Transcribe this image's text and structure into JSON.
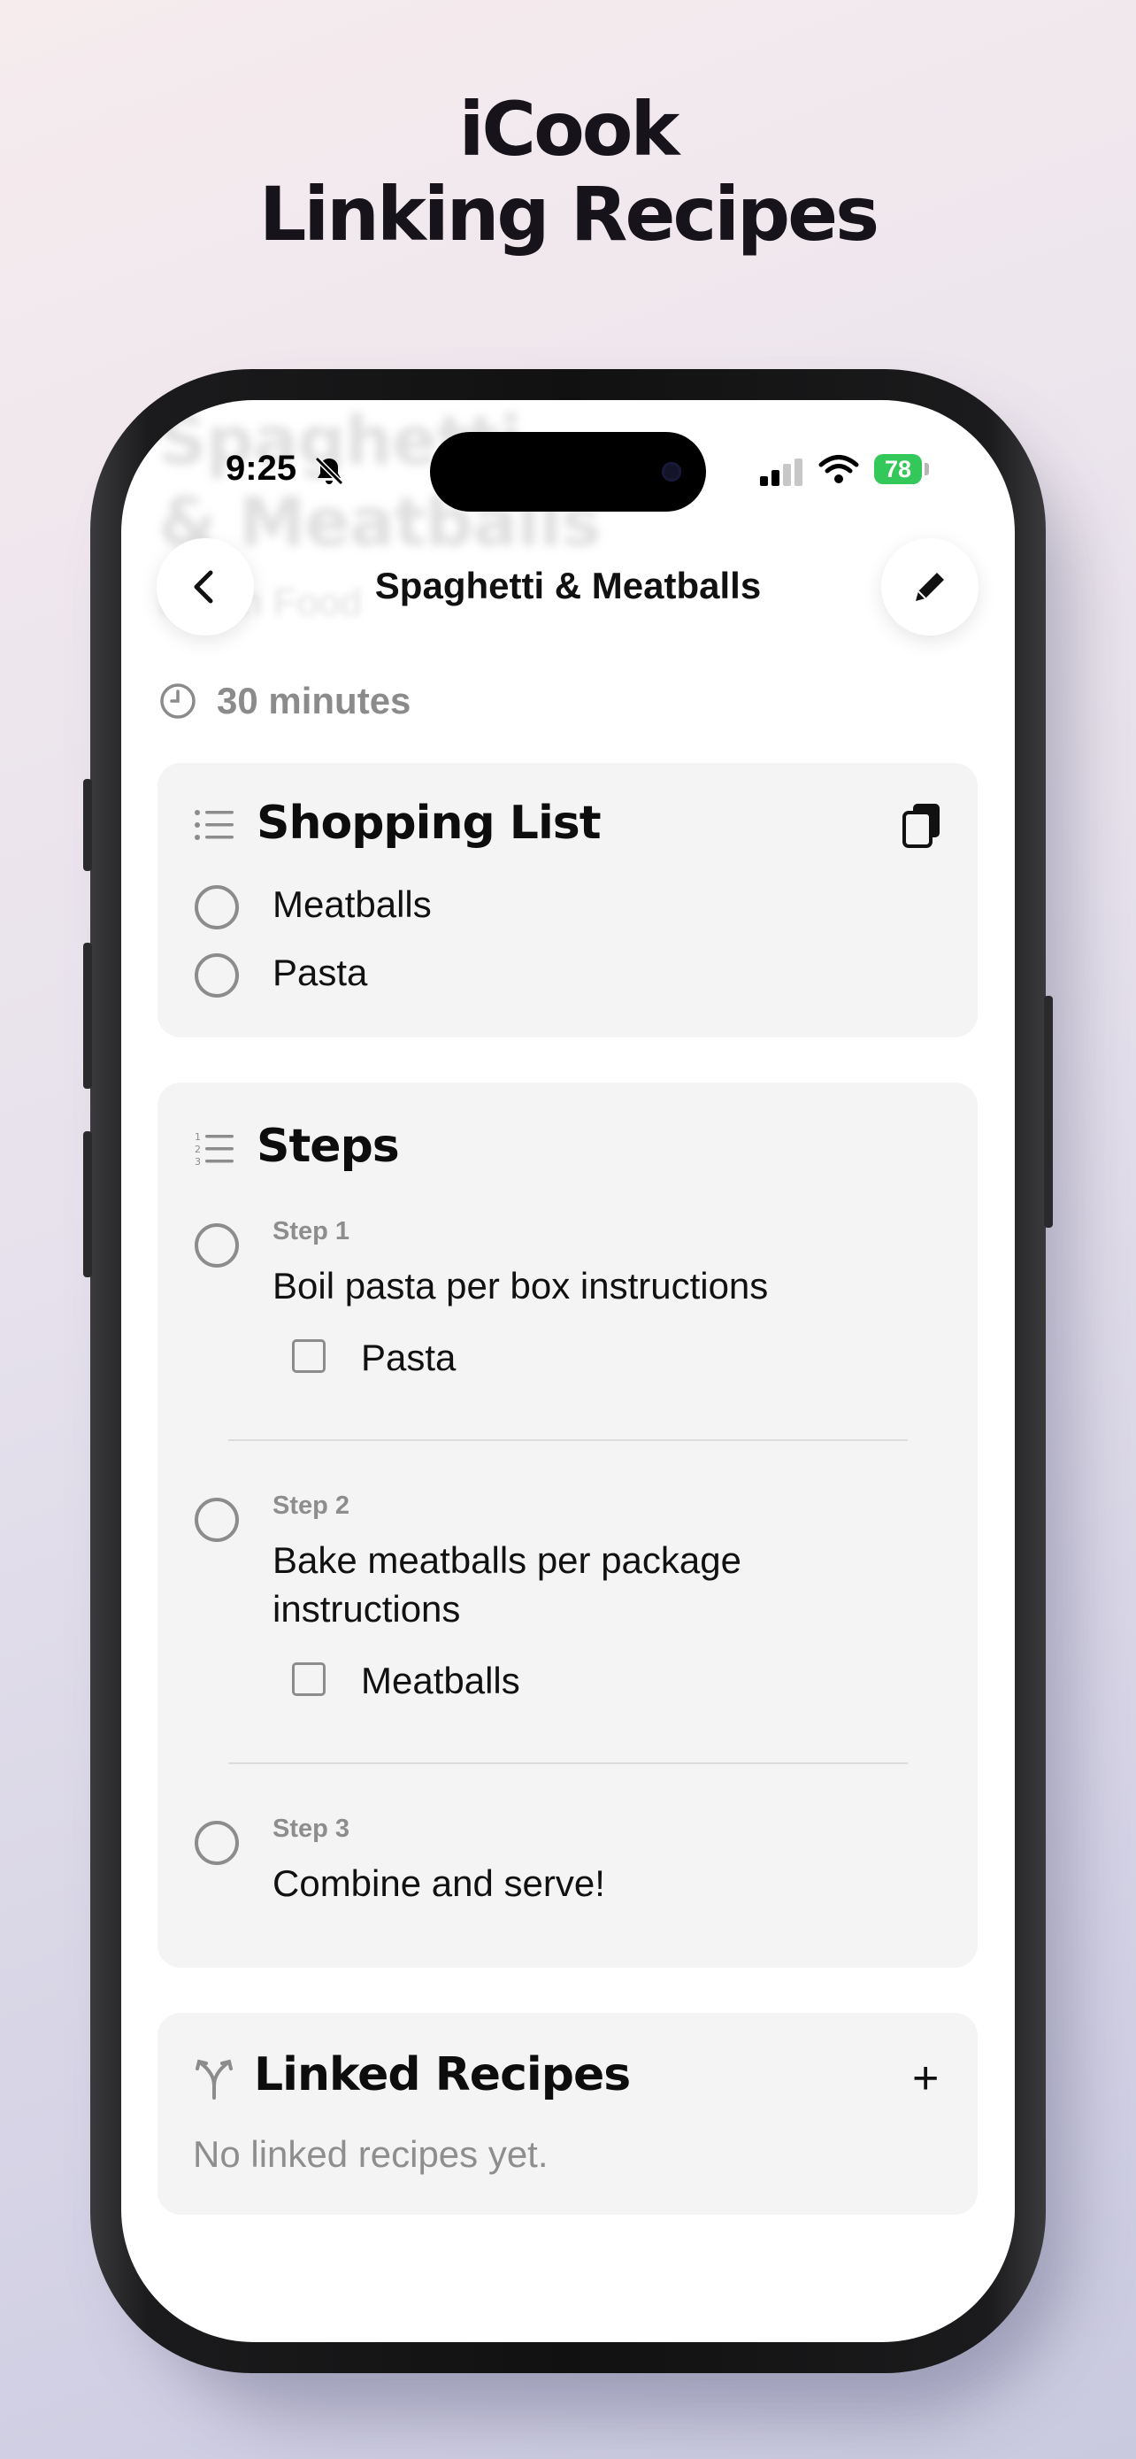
{
  "promo": {
    "line1": "iCook",
    "line2": "Linking Recipes"
  },
  "status_bar": {
    "time": "9:25",
    "battery": "78"
  },
  "background_header": {
    "title_line1": "Spaghetti",
    "title_line2": "& Meatballs",
    "subtitle": "Italian Food"
  },
  "nav": {
    "title": "Spaghetti & Meatballs",
    "back_icon": "chevron-left-icon",
    "edit_icon": "pencil-icon"
  },
  "recipe": {
    "duration": "30 minutes"
  },
  "shopping_list": {
    "title": "Shopping List",
    "items": [
      {
        "label": "Meatballs"
      },
      {
        "label": "Pasta"
      }
    ]
  },
  "steps": {
    "title": "Steps",
    "items": [
      {
        "label": "Step 1",
        "text": "Boil pasta per box instructions",
        "ingredients": [
          "Pasta"
        ]
      },
      {
        "label": "Step 2",
        "text_line1": "Bake meatballs per package",
        "text_line2": "instructions",
        "ingredients": [
          "Meatballs"
        ]
      },
      {
        "label": "Step 3",
        "text": "Combine and serve!"
      }
    ]
  },
  "linked_recipes": {
    "title": "Linked Recipes",
    "add_label": "+",
    "empty_text": "No linked recipes yet."
  },
  "colors": {
    "accent_battery": "#34c759",
    "card_background": "#f4f4f4",
    "secondary_text": "#8b8b8b"
  }
}
